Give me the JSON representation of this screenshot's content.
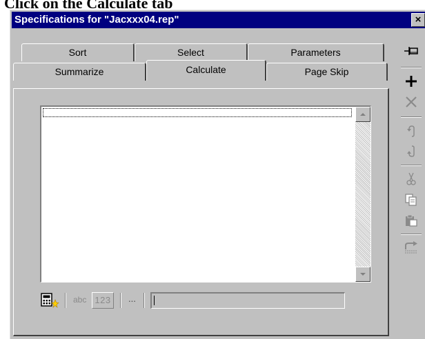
{
  "caption": {
    "prefix": "Click on the ",
    "emphasis": "Calculate",
    "suffix": " tab"
  },
  "dialog": {
    "title": "Specifications for \"Jacxxx04.rep\"",
    "close_label": "×"
  },
  "tabs": {
    "back_row": [
      {
        "id": "sort",
        "label": "Sort"
      },
      {
        "id": "select",
        "label": "Select"
      },
      {
        "id": "parameters",
        "label": "Parameters"
      }
    ],
    "front_row": [
      {
        "id": "summarize",
        "label": "Summarize"
      },
      {
        "id": "calculate",
        "label": "Calculate",
        "active": true
      },
      {
        "id": "page-skip",
        "label": "Page Skip"
      }
    ]
  },
  "calculate_panel": {
    "abc_label": "abc",
    "numeric_label": "123",
    "ellipsis_label": "...",
    "expression_value": ""
  },
  "toolbar": {
    "icons": [
      "pin-icon",
      "add-icon",
      "delete-icon",
      "move-up-icon",
      "move-down-icon",
      "cut-icon",
      "copy-icon",
      "paste-icon",
      "validate-icon"
    ]
  },
  "colors": {
    "face": "#c0c0c0",
    "titlebar": "#000080",
    "add_icon": "#000000",
    "disabled": "#8a8a8a"
  }
}
